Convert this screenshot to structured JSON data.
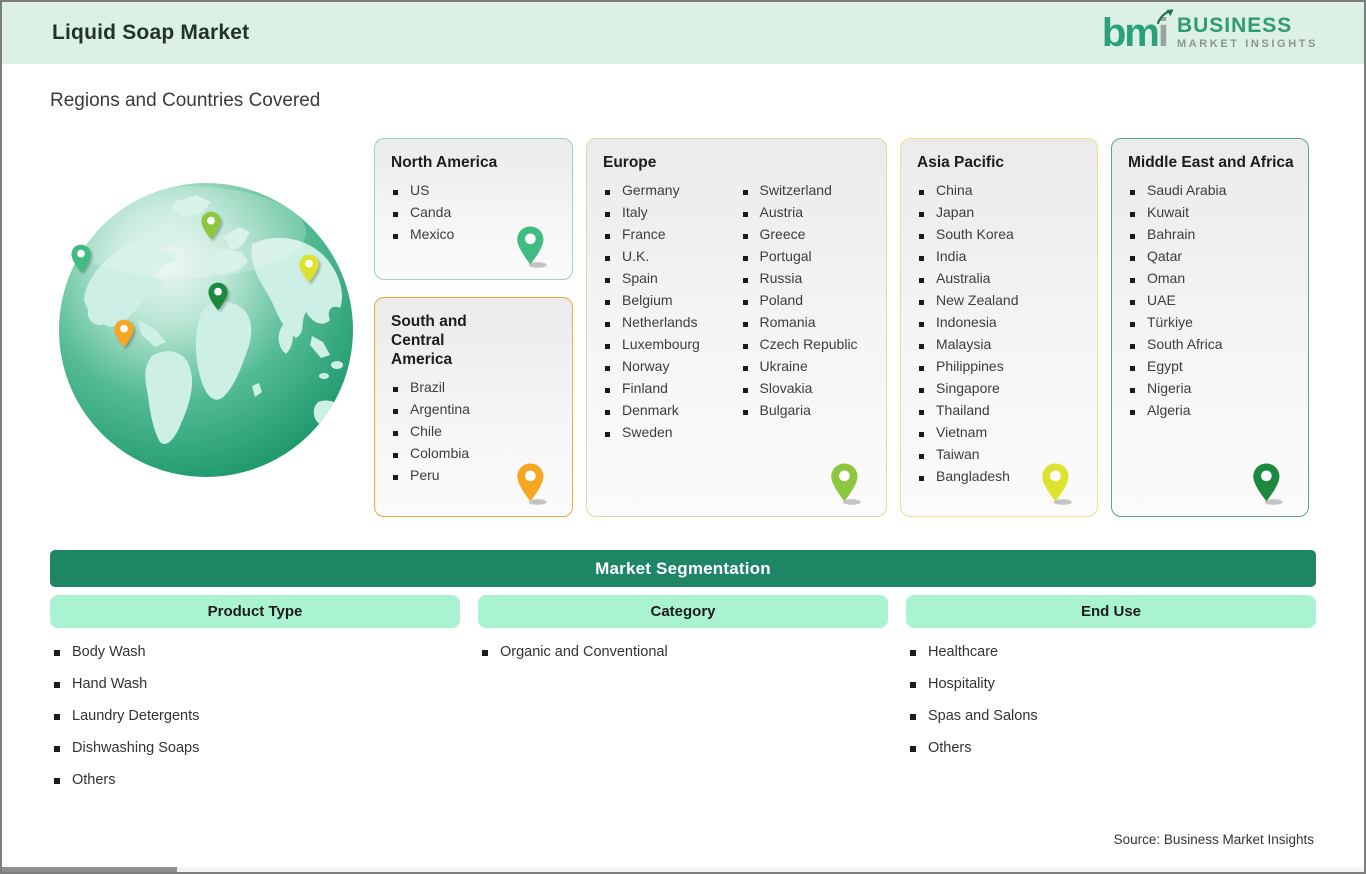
{
  "header": {
    "title": "Liquid Soap Market",
    "logo": {
      "mark_green": "bm",
      "mark_gray": "i",
      "line1": "BUSINESS",
      "line2": "MARKET INSIGHTS",
      "brand_green": "#2e9b70",
      "brand_gray": "#8b9691"
    }
  },
  "section_title": "Regions and Countries Covered",
  "regions": [
    {
      "name": "North America",
      "border_color": "#94d9b2",
      "pin_color": "#3fbd81",
      "countries": [
        "US",
        "Canda",
        "Mexico"
      ]
    },
    {
      "name": "South and Central America",
      "border_color": "#f2a93e",
      "pin_color": "#f5a623",
      "countries": [
        "Brazil",
        "Argentina",
        "Chile",
        "Colombia",
        "Peru"
      ]
    },
    {
      "name": "Europe",
      "border_color": "#cfe0a0",
      "pin_color": "#8dc63f",
      "countries": [
        "Germany",
        "Italy",
        "France",
        "U.K.",
        "Spain",
        "Belgium",
        "Netherlands",
        "Luxembourg",
        "Norway",
        "Finland",
        "Denmark",
        "Sweden",
        "Switzerland",
        "Austria",
        "Greece",
        "Portugal",
        "Russia",
        "Poland",
        "Romania",
        "Czech Republic",
        "Ukraine",
        "Slovakia",
        "Bulgaria"
      ]
    },
    {
      "name": "Asia Pacific",
      "border_color": "#ebe48c",
      "pin_color": "#dde32d",
      "countries": [
        "China",
        "Japan",
        "South Korea",
        "India",
        "Australia",
        "New Zealand",
        "Indonesia",
        "Malaysia",
        "Philippines",
        "Singapore",
        "Thailand",
        "Vietnam",
        "Taiwan",
        "Bangladesh"
      ]
    },
    {
      "name": "Middle East and Africa",
      "border_color": "#5aa983",
      "pin_color": "#1c8a3e",
      "countries": [
        "Saudi Arabia",
        "Kuwait",
        "Bahrain",
        "Qatar",
        "Oman",
        "UAE",
        "Türkiye",
        "South Africa",
        "Egypt",
        "Nigeria",
        "Algeria"
      ]
    }
  ],
  "segmentation": {
    "title": "Market Segmentation",
    "bar_color": "#1e8565",
    "pill_color": "#a9f2d2",
    "columns": [
      {
        "header": "Product Type",
        "items": [
          "Body Wash",
          "Hand Wash",
          "Laundry Detergents",
          "Dishwashing Soaps",
          "Others"
        ]
      },
      {
        "header": "Category",
        "items": [
          "Organic and Conventional"
        ]
      },
      {
        "header": "End Use",
        "items": [
          "Healthcare",
          "Hospitality",
          "Spas and Salons",
          "Others"
        ]
      }
    ]
  },
  "source": "Source: Business Market Insights"
}
